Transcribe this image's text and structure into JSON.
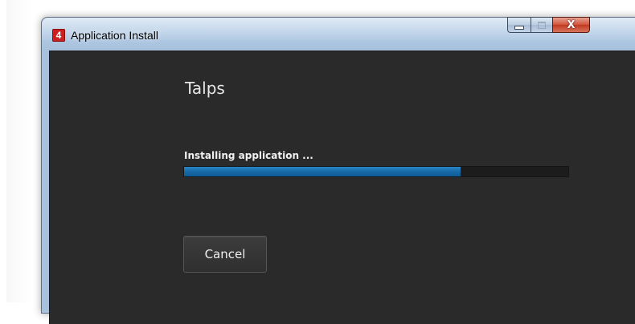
{
  "window": {
    "title": "Application Install",
    "icon": "adobe-air-icon",
    "icon_glyph": "4",
    "caption_buttons": {
      "minimize": "minimize-icon",
      "maximize": "maximize-icon",
      "close_glyph": "X"
    }
  },
  "installer": {
    "app_name": "Talps",
    "status": "Installing application ...",
    "progress_fraction": 0.72,
    "cancel_label": "Cancel"
  },
  "colors": {
    "client_bg": "#2a2a2a",
    "progress_fill": "#1769a8",
    "progress_track": "#1c1c1c",
    "close_button": "#c13a21"
  }
}
